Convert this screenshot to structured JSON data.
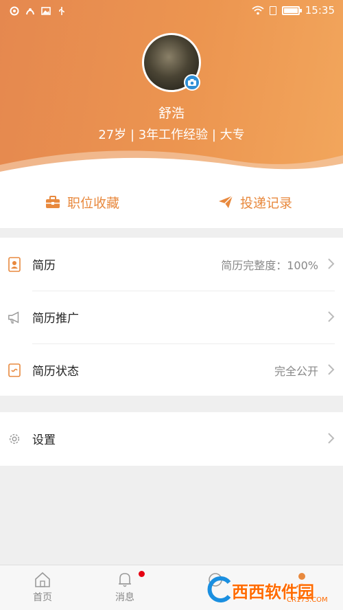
{
  "status_bar": {
    "time": "15:35"
  },
  "profile": {
    "name": "舒浩",
    "info": "27岁 | 3年工作经验 | 大专"
  },
  "quick_actions": [
    {
      "label": "职位收藏",
      "icon": "briefcase-icon"
    },
    {
      "label": "投递记录",
      "icon": "paper-plane-icon"
    }
  ],
  "resume_section": [
    {
      "label": "简历",
      "value": "简历完整度：100%",
      "icon": "resume-icon"
    },
    {
      "label": "简历推广",
      "value": "",
      "icon": "megaphone-icon"
    },
    {
      "label": "简历状态",
      "value": "完全公开",
      "icon": "status-icon"
    }
  ],
  "settings_section": [
    {
      "label": "设置",
      "icon": "gear-icon"
    }
  ],
  "tabbar": [
    {
      "label": "首页",
      "icon": "home-icon"
    },
    {
      "label": "消息",
      "icon": "bell-icon"
    }
  ],
  "watermark": {
    "text": "西西软件园",
    "sub": "CR173.COM"
  },
  "colors": {
    "accent": "#e8893e",
    "header_start": "#e5884f",
    "header_end": "#f2a65c",
    "badge": "#2f8fd6"
  }
}
